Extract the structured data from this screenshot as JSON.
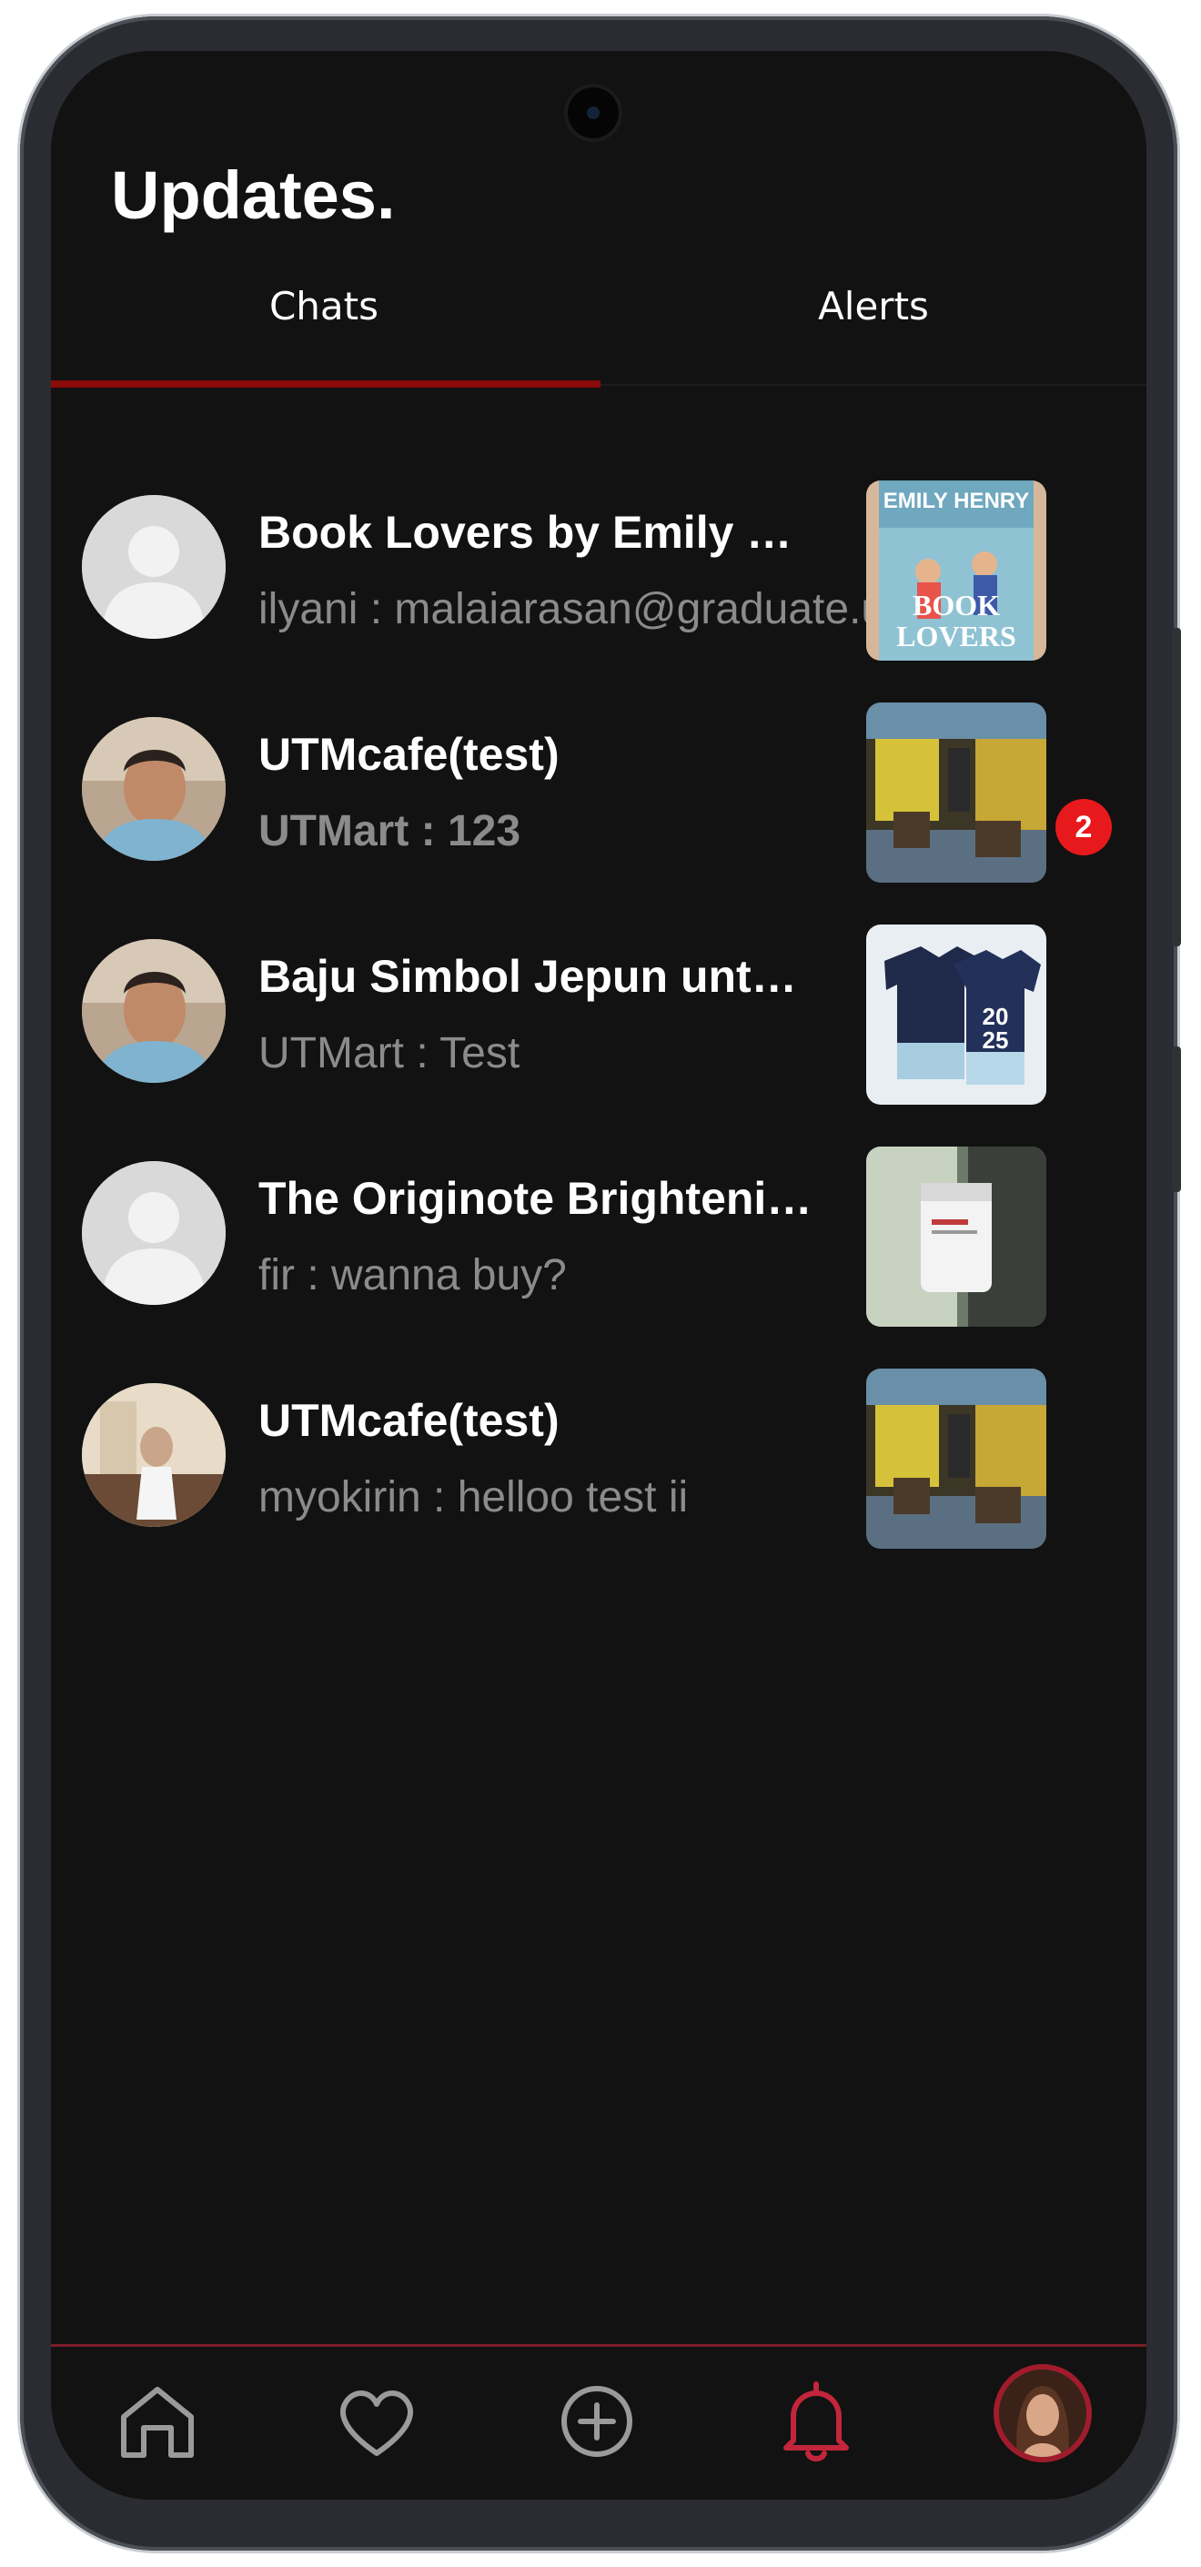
{
  "header": {
    "title": "Updates."
  },
  "tabs": [
    {
      "label": "Chats",
      "active": true
    },
    {
      "label": "Alerts",
      "active": false
    }
  ],
  "chats": [
    {
      "title": "Book Lovers by Emily Henry",
      "preview": "ilyani : malaiarasan@graduate.utm.my",
      "avatar": "default-avatar-icon",
      "thumbnail": "book-cover-image",
      "unread": null
    },
    {
      "title": "UTMcafe(test)",
      "preview": "UTMart : 123",
      "avatar": "user-photo",
      "thumbnail": "cafe-image",
      "unread": "2"
    },
    {
      "title": "Baju Simbol Jepun untuk dijual",
      "preview": "UTMart : Test",
      "avatar": "user-photo",
      "thumbnail": "jersey-image",
      "unread": null
    },
    {
      "title": "The Originote Brightening Moisturizer",
      "preview": "fir : wanna buy?",
      "avatar": "default-avatar-icon",
      "thumbnail": "product-jar-image",
      "unread": null
    },
    {
      "title": "UTMcafe(test)",
      "preview": "myokirin : helloo test ii",
      "avatar": "user-photo",
      "thumbnail": "cafe-image",
      "unread": null
    }
  ],
  "bottom_nav": [
    {
      "icon": "home-icon",
      "active": false
    },
    {
      "icon": "heart-icon",
      "active": false
    },
    {
      "icon": "add-circle-icon",
      "active": false
    },
    {
      "icon": "bell-icon",
      "active": true
    },
    {
      "icon": "profile-avatar",
      "active": false
    }
  ],
  "colors": {
    "background": "#121212",
    "accent": "#8b0a0a",
    "badge": "#e8191c",
    "active_nav": "#c2263a",
    "inactive_nav": "#9a9a9a",
    "preview_text": "#8b8b8b"
  }
}
